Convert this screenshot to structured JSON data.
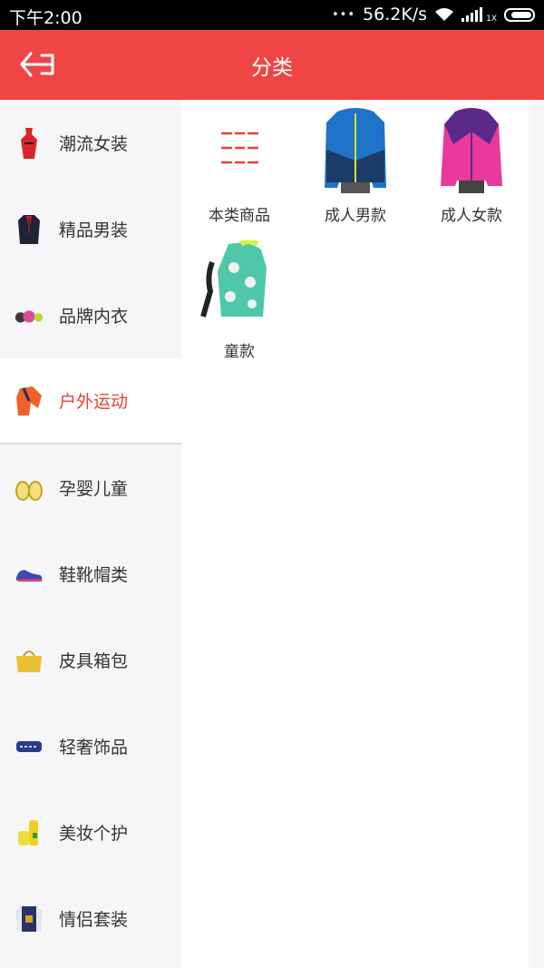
{
  "status_bar": {
    "time": "下午2:00",
    "dots": "•••",
    "speed": "56.2K/s",
    "sim": "1X"
  },
  "header": {
    "title": "分类",
    "back_icon": "back-arrow-icon",
    "color": "#f04545"
  },
  "sidebar": {
    "items": [
      {
        "label": "潮流女装",
        "icon": "womens-dress-icon",
        "active": false
      },
      {
        "label": "精品男装",
        "icon": "mens-suit-icon",
        "active": false
      },
      {
        "label": "品牌内衣",
        "icon": "underwear-icon",
        "active": false
      },
      {
        "label": "户外运动",
        "icon": "outdoor-jacket-icon",
        "active": true
      },
      {
        "label": "孕婴儿童",
        "icon": "baby-shoes-icon",
        "active": false
      },
      {
        "label": "鞋靴帽类",
        "icon": "sneaker-icon",
        "active": false
      },
      {
        "label": "皮具箱包",
        "icon": "handbag-icon",
        "active": false
      },
      {
        "label": "轻奢饰品",
        "icon": "bracelet-icon",
        "active": false
      },
      {
        "label": "美妆个护",
        "icon": "cosmetics-bottle-icon",
        "active": false
      },
      {
        "label": "情侣套装",
        "icon": "couple-jacket-icon",
        "active": false
      }
    ],
    "active_color": "#e8403b"
  },
  "content": {
    "items": [
      {
        "label": "本类商品",
        "icon": "grid-lines-icon"
      },
      {
        "label": "成人男款",
        "icon": "blue-jacket-icon"
      },
      {
        "label": "成人女款",
        "icon": "pink-jacket-icon"
      },
      {
        "label": "童款",
        "icon": "kids-jacket-icon"
      }
    ]
  }
}
